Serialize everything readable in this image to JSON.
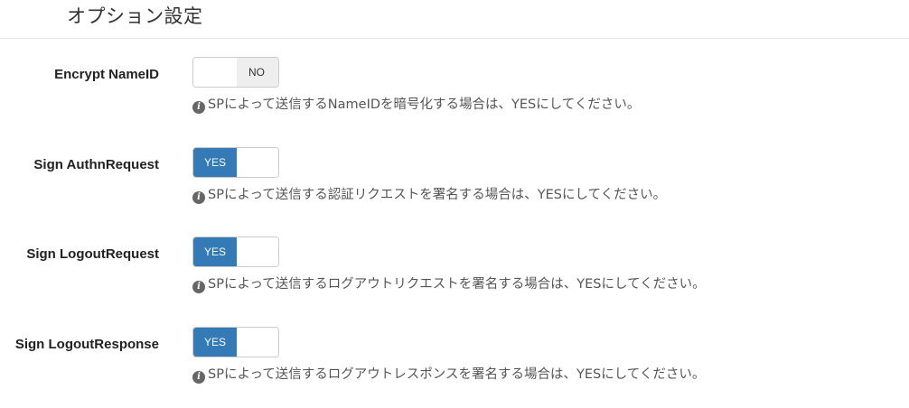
{
  "section": {
    "title": "オプション設定"
  },
  "info_icon_glyph": "i",
  "colors": {
    "accent": "#337ab7",
    "off_bg": "#eeeeee",
    "border": "#cccccc"
  },
  "rows": [
    {
      "label": "Encrypt NameID",
      "state": "NO",
      "value_text": "NO",
      "help": "SPによって送信するNameIDを暗号化する場合は、YESにしてください。"
    },
    {
      "label": "Sign AuthnRequest",
      "state": "YES",
      "value_text": "YES",
      "help": "SPによって送信する認証リクエストを署名する場合は、YESにしてください。"
    },
    {
      "label": "Sign LogoutRequest",
      "state": "YES",
      "value_text": "YES",
      "help": "SPによって送信するログアウトリクエストを署名する場合は、YESにしてください。"
    },
    {
      "label": "Sign LogoutResponse",
      "state": "YES",
      "value_text": "YES",
      "help": "SPによって送信するログアウトレスポンスを署名する場合は、YESにしてください。"
    }
  ]
}
